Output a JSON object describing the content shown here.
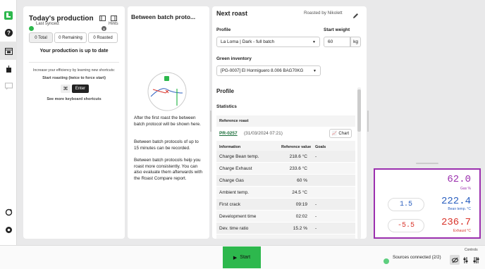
{
  "left_panel": {
    "title": "Today's production",
    "last_synced": "Last synced:",
    "hints": "Hints",
    "tabs": [
      "0 Total",
      "0 Remaining",
      "0 Roasted"
    ],
    "status": "Your production is up to date",
    "efficiency_text": "Increase your efficiency by learning new shortcuts:",
    "shortcut_label": "Start roasting (twice to force start)",
    "key_cmd": "⌘",
    "key_enter": "Enter",
    "more_shortcuts": "See more keyboard shortcuts"
  },
  "middle_panel": {
    "title": "Between batch proto...",
    "p1": "After the first roast the between batch protocol will be shown here.",
    "p2": "Between batch protocols of up to 15 minutes can be recorded.",
    "p3": "Between batch protocols help you roast more consistently. You can also evaluate them afterwards with the Roast Compare report."
  },
  "right_panel": {
    "title": "Next roast",
    "roasted_by": "Roasted by Nikolett",
    "profile_label": "Profile",
    "profile_value": "La Loma | Dark - full batch",
    "start_weight_label": "Start weight",
    "start_weight_value": "60",
    "start_weight_unit": "kg",
    "green_label": "Green inventory",
    "green_value": "[PG-0007] El Hormiguero 8.006 BAG70KG",
    "profile_section": "Profile",
    "statistics": "Statistics",
    "reference_roast": "Reference roast",
    "ref_id": "PR-0257",
    "ref_date": "(31/03/2024 07:21)",
    "chart_btn": "Chart",
    "col_info": "Information",
    "col_ref": "Reference value",
    "col_goals": "Goals",
    "rows": [
      {
        "name": "Charge Bean temp.",
        "value": "218.6 °C",
        "goal": "-"
      },
      {
        "name": "Charge Exhaust",
        "value": "233.6 °C",
        "goal": ""
      },
      {
        "name": "Charge Gas",
        "value": "60 %",
        "goal": ""
      },
      {
        "name": "Ambient temp.",
        "value": "24.5 °C",
        "goal": ""
      },
      {
        "name": "First crack",
        "value": "09:19",
        "goal": "-"
      },
      {
        "name": "Development time",
        "value": "02:02",
        "goal": "-"
      },
      {
        "name": "Dev. time ratio",
        "value": "15.2 %",
        "goal": "-"
      }
    ]
  },
  "gauges": {
    "gas_value": "62.0",
    "gas_label": "Gas %",
    "bean_delta": "1.5",
    "bean_value": "222.4",
    "bean_label": "Bean temp. °C",
    "exhaust_delta": "-5.5",
    "exhaust_value": "236.7",
    "exhaust_label": "Exhaust °C",
    "colors": {
      "gas": "#9b2fae",
      "bean": "#2a5fbf",
      "exhaust": "#d9342b"
    }
  },
  "bottom": {
    "start": "Start",
    "sources": "Sources connected (2/2)",
    "controls": "Controls"
  }
}
